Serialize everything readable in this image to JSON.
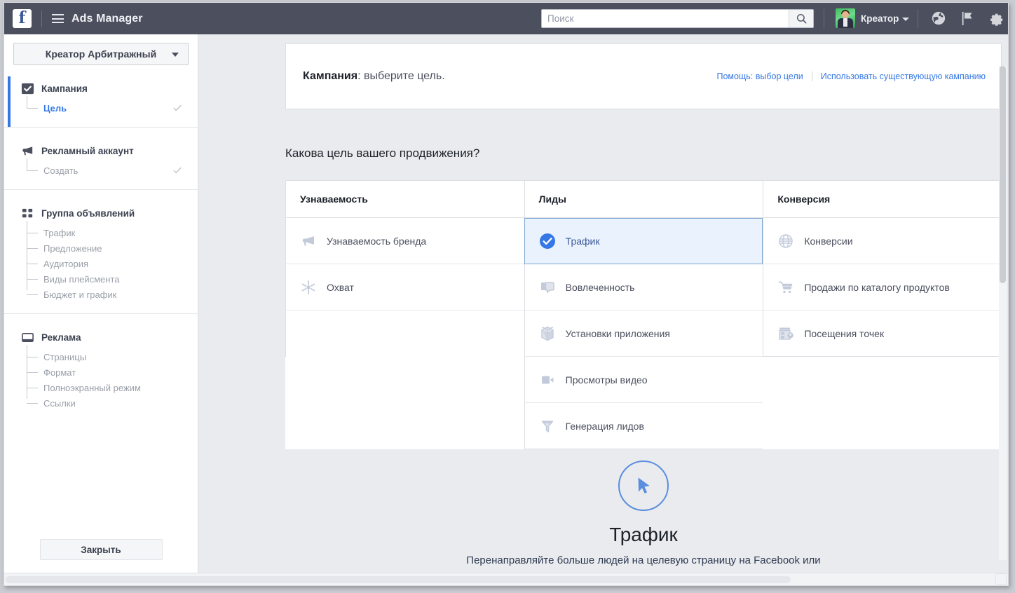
{
  "topbar": {
    "logo": "f",
    "menu_icon": "hamburger-icon",
    "app_title": "Ads Manager",
    "search": {
      "value": "",
      "placeholder": "Поиск",
      "icon": "search-icon"
    },
    "user": {
      "name": "Креатор",
      "avatar": "user-avatar",
      "caret": "chevron-down-icon"
    },
    "icons": [
      "globe-icon",
      "flag-icon",
      "gear-icon"
    ],
    "bg_color": "#4b4f5e"
  },
  "sidebar": {
    "account_selector": {
      "label": "Креатор Арбитражный",
      "caret": "chevron-down-icon"
    },
    "sections": [
      {
        "title": "Кампания",
        "icon": "campaign-checkbox-icon",
        "active": true,
        "items": [
          {
            "label": "Цель",
            "current": true,
            "done": true
          }
        ]
      },
      {
        "title": "Рекламный аккаунт",
        "icon": "megaphone-icon",
        "active": false,
        "items": [
          {
            "label": "Создать",
            "current": false,
            "done": true
          }
        ]
      },
      {
        "title": "Группа объявлений",
        "icon": "adset-grid-icon",
        "active": false,
        "items": [
          {
            "label": "Трафик",
            "current": false,
            "done": false
          },
          {
            "label": "Предложение",
            "current": false,
            "done": false
          },
          {
            "label": "Аудитория",
            "current": false,
            "done": false
          },
          {
            "label": "Виды плейсмента",
            "current": false,
            "done": false
          },
          {
            "label": "Бюджет и график",
            "current": false,
            "done": false
          }
        ]
      },
      {
        "title": "Реклама",
        "icon": "ad-window-icon",
        "active": false,
        "items": [
          {
            "label": "Страницы",
            "current": false,
            "done": false
          },
          {
            "label": "Формат",
            "current": false,
            "done": false
          },
          {
            "label": "Полноэкранный режим",
            "current": false,
            "done": false
          },
          {
            "label": "Ссылки",
            "current": false,
            "done": false
          }
        ]
      }
    ],
    "close_button": "Закрыть"
  },
  "campaign_card": {
    "title_bold": "Кампания",
    "title_rest": ": выберите цель.",
    "help_link": "Помощь: выбор цели",
    "existing_link": "Использовать существующую кампанию"
  },
  "question": "Какова цель вашего продвижения?",
  "objectives": {
    "columns": [
      {
        "header": "Узнаваемость",
        "items": [
          {
            "label": "Узнаваемость бренда",
            "icon": "megaphone-icon",
            "selected": false
          },
          {
            "label": "Охват",
            "icon": "reach-star-icon",
            "selected": false
          }
        ]
      },
      {
        "header": "Лиды",
        "items": [
          {
            "label": "Трафик",
            "icon": "check-circle-icon",
            "selected": true
          },
          {
            "label": "Вовлеченность",
            "icon": "engagement-thumb-icon",
            "selected": false
          },
          {
            "label": "Установки приложения",
            "icon": "app-box-icon",
            "selected": false
          },
          {
            "label": "Просмотры видео",
            "icon": "video-camera-icon",
            "selected": false
          },
          {
            "label": "Генерация лидов",
            "icon": "lead-funnel-icon",
            "selected": false
          }
        ]
      },
      {
        "header": "Конверсия",
        "items": [
          {
            "label": "Конверсии",
            "icon": "globe-grid-icon",
            "selected": false
          },
          {
            "label": "Продажи по каталогу продуктов",
            "icon": "shopping-cart-icon",
            "selected": false
          },
          {
            "label": "Посещения точек",
            "icon": "storefront-icon",
            "selected": false
          }
        ]
      }
    ]
  },
  "hero": {
    "icon": "cursor-click-icon",
    "title": "Трафик",
    "description": "Перенаправляйте больше людей на целевую страницу на Facebook или"
  },
  "colors": {
    "accent": "#3578e5",
    "selected_bg": "#eaf3fd",
    "selected_border": "#7aa6d2",
    "page_bg": "#e9ebee",
    "topbar": "#4b4f5e",
    "muted_text": "#9aa0a8",
    "icon_muted": "#c3cbdb"
  }
}
